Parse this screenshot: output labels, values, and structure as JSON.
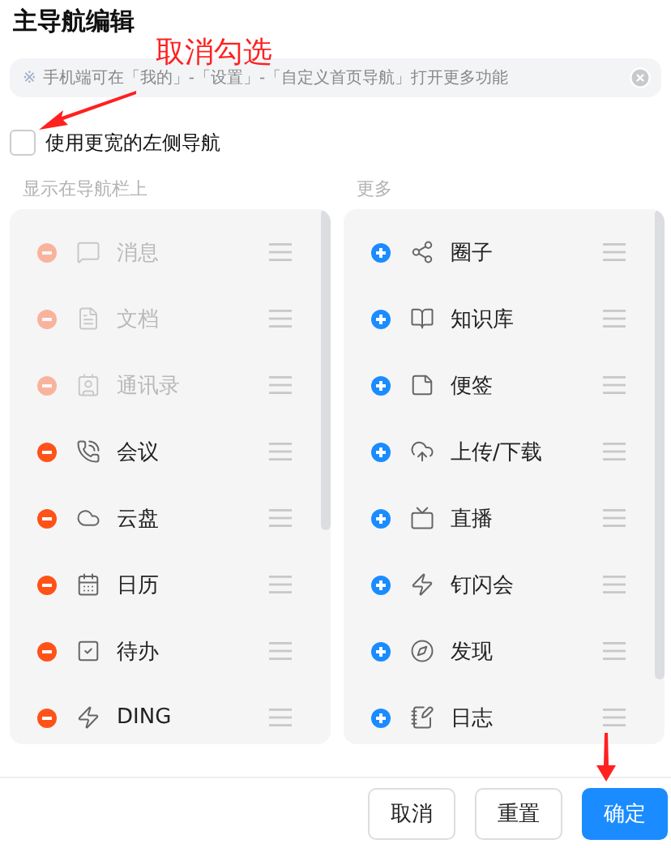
{
  "title": "主导航编辑",
  "annotation": "取消勾选",
  "notice": {
    "mark": "※",
    "text": "手机端可在「我的」-「设置」-「自定义首页导航」打开更多功能"
  },
  "wide_left_nav": {
    "label": "使用更宽的左侧导航",
    "checked": false
  },
  "shown_column": {
    "heading": "显示在导航栏上",
    "items": [
      {
        "label": "消息",
        "disabled": true
      },
      {
        "label": "文档",
        "disabled": true
      },
      {
        "label": "通讯录",
        "disabled": true
      },
      {
        "label": "会议",
        "disabled": false
      },
      {
        "label": "云盘",
        "disabled": false
      },
      {
        "label": "日历",
        "disabled": false
      },
      {
        "label": "待办",
        "disabled": false
      },
      {
        "label": "DING",
        "disabled": false
      }
    ]
  },
  "more_column": {
    "heading": "更多",
    "items": [
      {
        "label": "圈子"
      },
      {
        "label": "知识库"
      },
      {
        "label": "便签"
      },
      {
        "label": "上传/下载"
      },
      {
        "label": "直播"
      },
      {
        "label": "钉闪会"
      },
      {
        "label": "发现"
      },
      {
        "label": "日志"
      }
    ]
  },
  "buttons": [
    {
      "label": "取消",
      "kind": "secondary"
    },
    {
      "label": "重置",
      "kind": "secondary"
    },
    {
      "label": "确定",
      "kind": "primary"
    }
  ]
}
